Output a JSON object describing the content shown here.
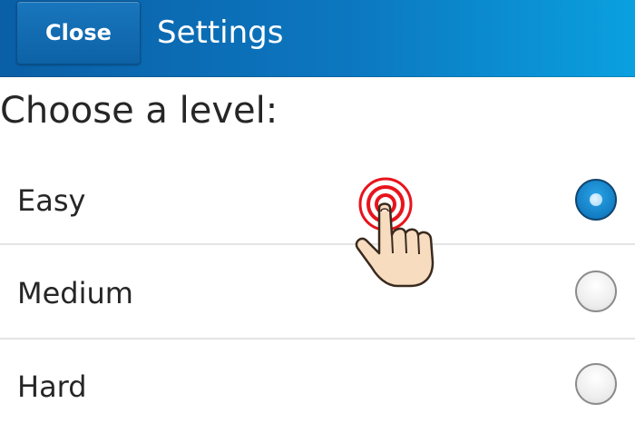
{
  "header": {
    "close_label": "Close",
    "title": "Settings"
  },
  "main": {
    "heading": "Choose a level:",
    "options": [
      {
        "label": "Easy",
        "selected": true
      },
      {
        "label": "Medium",
        "selected": false
      },
      {
        "label": "Hard",
        "selected": false
      }
    ]
  },
  "colors": {
    "header_gradient_start": "#0a5fa6",
    "header_gradient_end": "#0aa0df",
    "radio_selected": "#137dc4",
    "touch_ring": "#e8141c",
    "hand_skin": "#f7dcc0"
  },
  "icons": {
    "touch": "pointing-hand-icon"
  }
}
